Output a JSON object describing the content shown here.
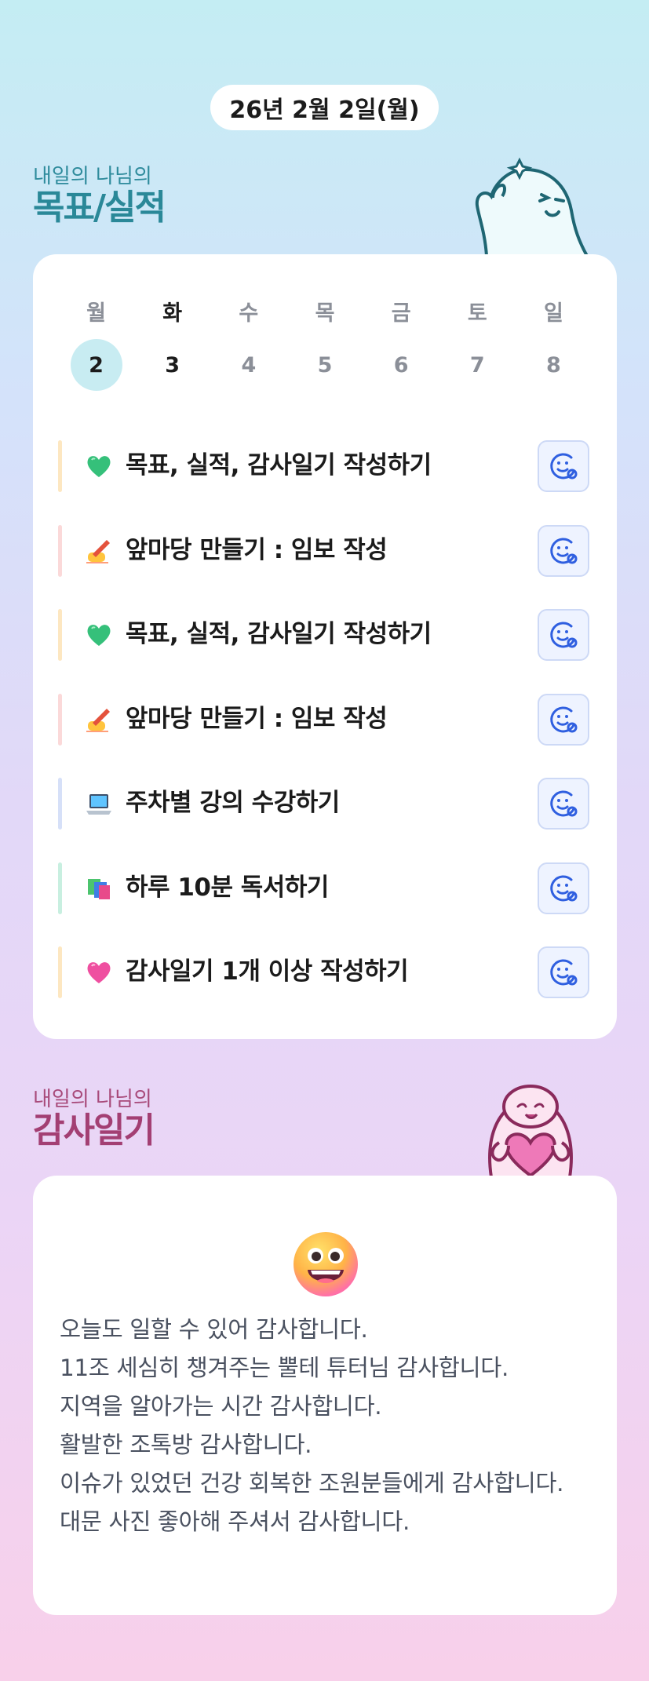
{
  "date_label": "26년 2월 2일(월)",
  "goals_section": {
    "subtitle": "내일의 나님의",
    "title": "목표/실적"
  },
  "gratitude_section": {
    "subtitle": "내일의 나님의",
    "title": "감사일기"
  },
  "calendar": {
    "weekdays": [
      "월",
      "화",
      "수",
      "목",
      "금",
      "토",
      "일"
    ],
    "days": [
      "2",
      "3",
      "4",
      "5",
      "6",
      "7",
      "8"
    ],
    "selected_index": 0
  },
  "goals": [
    {
      "icon": "green-heart-icon",
      "text": "목표, 실적, 감사일기 작성하기",
      "bar_color": "#fde7c1"
    },
    {
      "icon": "writing-hand-icon",
      "text": "앞마당 만들기 : 임보 작성",
      "bar_color": "#fbd9d9"
    },
    {
      "icon": "green-heart-icon",
      "text": "목표, 실적, 감사일기 작성하기",
      "bar_color": "#fde7c1"
    },
    {
      "icon": "writing-hand-icon",
      "text": "앞마당 만들기 : 임보 작성",
      "bar_color": "#fbd9d9"
    },
    {
      "icon": "laptop-icon",
      "text": "주차별 강의 수강하기",
      "bar_color": "#d6e0f8"
    },
    {
      "icon": "books-icon",
      "text": "하루 10분 독서하기",
      "bar_color": "#c8efe0"
    },
    {
      "icon": "pink-heart-icon",
      "text": "감사일기 1개 이상 작성하기",
      "bar_color": "#fde7c1"
    }
  ],
  "gratitude": {
    "emoji": "grinning-face-icon",
    "lines": [
      "오늘도 일할 수 있어 감사합니다.",
      "11조 세심히 챙겨주는 뿔테 튜터님 감사합니다.",
      "지역을 알아가는 시간 감사합니다.",
      "활발한 조톡방 감사합니다.",
      "이슈가 있었던 건강 회복한 조원분들에게 감사합니다.",
      "대문 사진 좋아해 주셔서 감사합니다."
    ]
  },
  "colors": {
    "accent_teal": "#2a8898",
    "accent_pink": "#a33f73",
    "button_blue": "#2f5fe0"
  }
}
